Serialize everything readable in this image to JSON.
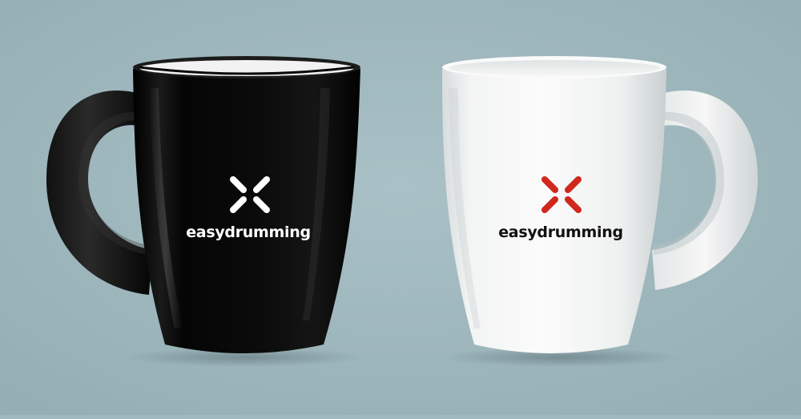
{
  "scene": {
    "background_color": "#9fb8bd"
  },
  "mugs": [
    {
      "finish": "glossy black",
      "body_color": "#0a0a0a",
      "inner_rim_color": "#f2f2f2",
      "logo": {
        "icon": "x-mark-icon",
        "icon_color": "#ffffff",
        "wordmark": "easydrumming",
        "wordmark_color": "#ffffff"
      }
    },
    {
      "finish": "glossy white",
      "body_color": "#f4f5f5",
      "inner_rim_color": "#e9ebeb",
      "logo": {
        "icon": "x-mark-icon",
        "icon_color": "#d0281e",
        "wordmark": "easydrumming",
        "wordmark_color": "#111111"
      }
    }
  ]
}
